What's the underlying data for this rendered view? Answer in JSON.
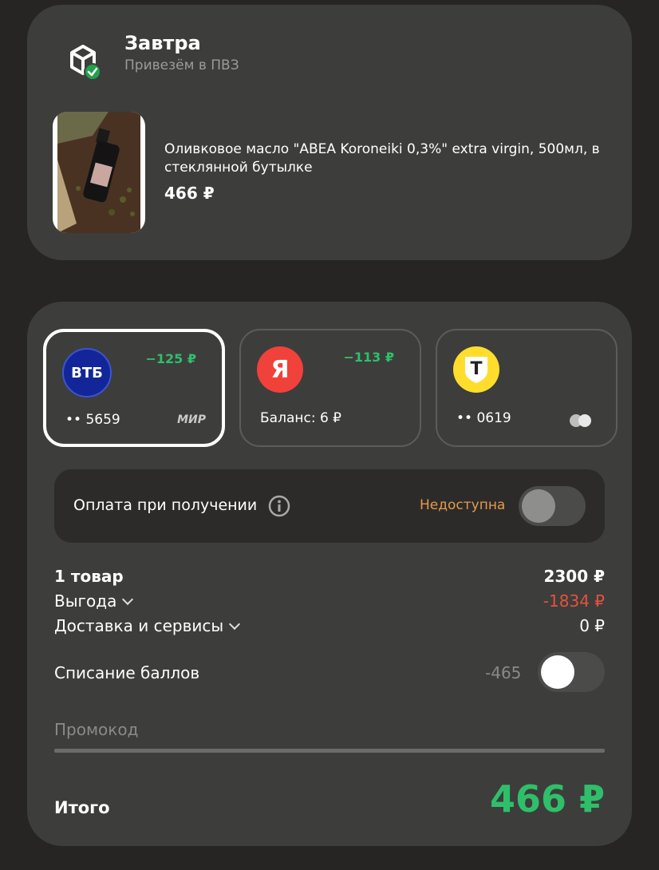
{
  "delivery": {
    "title": "Завтра",
    "subtitle": "Привезём в ПВЗ",
    "product_name": "Оливковое масло \"ABEA Koroneiki 0,3%\" extra virgin, 500мл, в стеклянной бутылке",
    "product_price": "466 ₽"
  },
  "payment_methods": [
    {
      "logo": "ВТБ",
      "cashback": "−125 ₽",
      "bottom": "•• 5659",
      "network": "МИР",
      "selected": true,
      "color": "#12269a"
    },
    {
      "logo": "Я",
      "cashback": "−113 ₽",
      "bottom": "Баланс: 6 ₽",
      "selected": false,
      "color": "#f0413a"
    },
    {
      "logo": "T",
      "cashback": "",
      "bottom": "•• 0619",
      "selected": false,
      "color": "#ffdd2d"
    }
  ],
  "cod": {
    "label": "Оплата при получении",
    "status": "Недоступна"
  },
  "summary": {
    "items_label": "1 товар",
    "items_value": "2300 ₽",
    "benefit_label": "Выгода",
    "benefit_value": "-1834 ₽",
    "delivery_label": "Доставка и сервисы",
    "delivery_value": "0 ₽",
    "points_label": "Списание баллов",
    "points_value": "-465"
  },
  "promo": {
    "placeholder": "Промокод"
  },
  "total": {
    "label": "Итого",
    "value": "466 ₽"
  },
  "colors": {
    "accent_green": "#2fbf6a",
    "discount_red": "#e5533d",
    "status_orange": "#e59a4a"
  }
}
